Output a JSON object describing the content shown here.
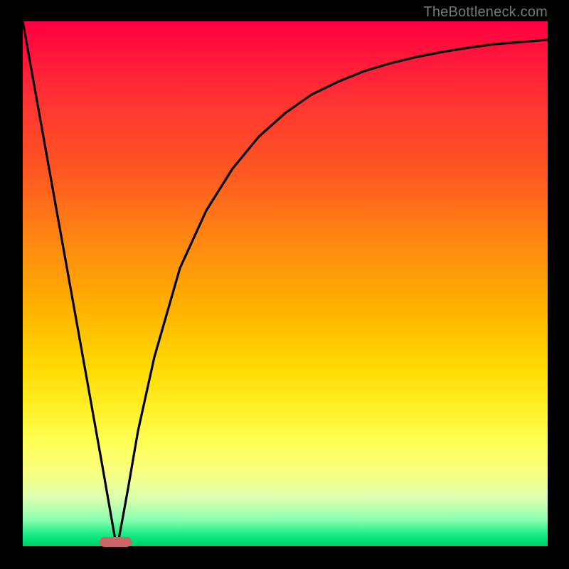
{
  "watermark": "TheBottleneck.com",
  "colors": {
    "background": "#000000",
    "gradient_top": "#ff0040",
    "gradient_bottom": "#00cc66",
    "curve": "#000000",
    "marker": "#cc6666",
    "watermark": "#777777"
  },
  "chart_data": {
    "type": "line",
    "title": "",
    "xlabel": "",
    "ylabel": "",
    "xlim": [
      0,
      100
    ],
    "ylim": [
      0,
      100
    ],
    "grid": false,
    "legend": false,
    "series": [
      {
        "name": "bottleneck-curve",
        "x": [
          0,
          5,
          10,
          15,
          17.5,
          18,
          19,
          20,
          22,
          25,
          30,
          35,
          40,
          45,
          50,
          55,
          60,
          65,
          70,
          75,
          80,
          85,
          90,
          95,
          100
        ],
        "y": [
          100,
          72,
          44,
          16,
          2,
          0,
          5,
          11,
          22,
          36,
          53,
          64,
          72,
          78,
          82.5,
          86,
          88.5,
          90.5,
          92,
          93.2,
          94.2,
          95,
          95.6,
          96.1,
          96.5
        ]
      }
    ],
    "annotations": [
      {
        "name": "minimum-marker",
        "x": 17.7,
        "y": 0,
        "shape": "pill",
        "color": "#cc6666"
      }
    ],
    "background_gradient": {
      "direction": "vertical",
      "stops": [
        {
          "pos": 0,
          "color": "#ff0040"
        },
        {
          "pos": 50,
          "color": "#ffb300"
        },
        {
          "pos": 80,
          "color": "#ffff55"
        },
        {
          "pos": 100,
          "color": "#00cc66"
        }
      ]
    }
  }
}
